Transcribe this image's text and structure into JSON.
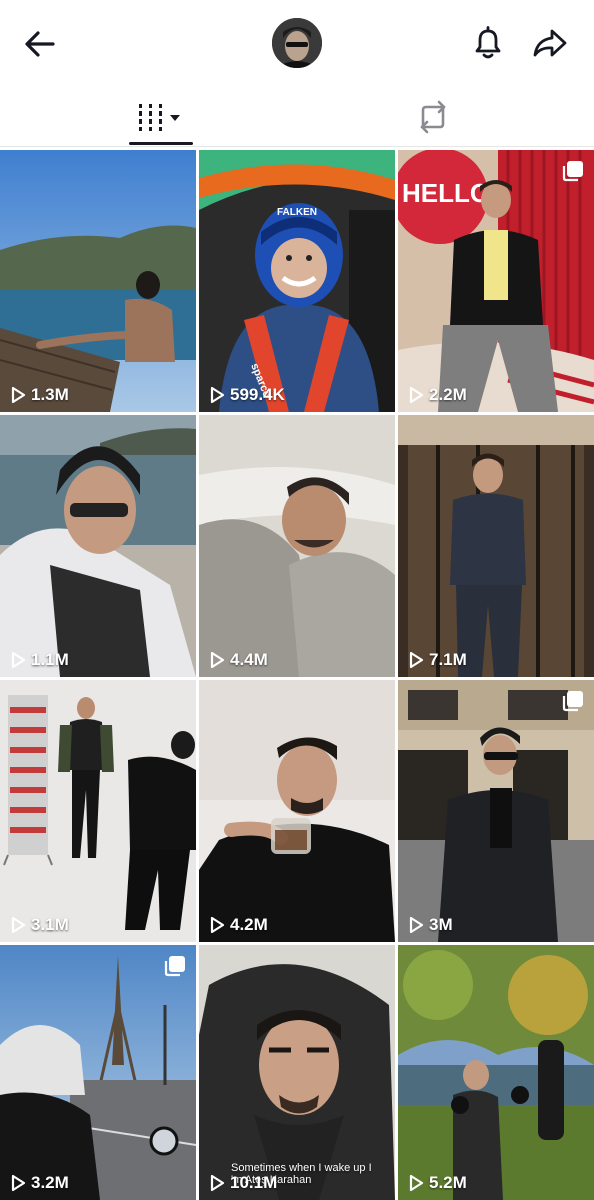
{
  "header": {
    "back_icon": "arrow-left-icon",
    "avatar_icon": "profile-avatar",
    "bell_icon": "bell-icon",
    "share_icon": "share-arrow-icon"
  },
  "tabs": [
    {
      "name": "videos",
      "icon": "grid-filter-icon",
      "active": true
    },
    {
      "name": "reposts",
      "icon": "repost-icon",
      "active": false
    }
  ],
  "videos": [
    {
      "views": "1.3M",
      "multi": false
    },
    {
      "views": "599.4K",
      "multi": false
    },
    {
      "views": "2.2M",
      "multi": true
    },
    {
      "views": "1.1M",
      "multi": false
    },
    {
      "views": "4.4M",
      "multi": false
    },
    {
      "views": "7.1M",
      "multi": false
    },
    {
      "views": "3.1M",
      "multi": false
    },
    {
      "views": "4.2M",
      "multi": false
    },
    {
      "views": "3M",
      "multi": true
    },
    {
      "views": "3.2M",
      "multi": true
    },
    {
      "views": "10.1M",
      "multi": false,
      "caption_line1": "Sometimes when I wake up I",
      "caption_line2": "'m Ateş Karahan"
    },
    {
      "views": "5.2M",
      "multi": false
    }
  ],
  "image_texts": {
    "hello_sign": "HELLO!",
    "helmet_brand": "FALKEN",
    "belt_brand": "sparco"
  },
  "colors": {
    "accent_dark": "#161823",
    "tab_inactive": "#8a8b91",
    "divider": "#e6e6e6"
  }
}
